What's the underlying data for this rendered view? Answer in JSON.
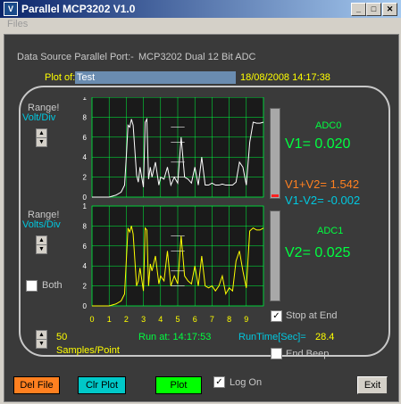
{
  "window": {
    "title": "Parallel MCP3202 V1.0",
    "icon": "app-icon"
  },
  "menu": {
    "files": "Files"
  },
  "header": {
    "source_label": "Data Source Parallel Port:-",
    "source_value": "MCP3202 Dual 12 Bit ADC",
    "plot_of_label": "Plot of:",
    "plot_of_value": "Test",
    "timestamp": "18/08/2008 14:17:38"
  },
  "left_controls": {
    "range1_label": "Range!",
    "range1_unit": "Volt/Div",
    "range2_label": "Range!",
    "range2_unit": "Volts/Div",
    "both_label": "Both",
    "samples_value": "50",
    "samples_label": "Samples/Point"
  },
  "right_panel": {
    "adc0_label": "ADC0",
    "v1": "V1= 0.020",
    "v1_plus_v2": "V1+V2= 1.542",
    "v1_minus_v2": "V1-V2=  -0.002",
    "adc1_label": "ADC1",
    "v2": "V2= 0.025",
    "stop_at_end_label": "Stop at End",
    "stop_at_end_checked": true,
    "runtime_label": "RunTime[Sec]=",
    "runtime_value": "28.4",
    "end_beep_label": "End Beep",
    "end_beep_checked": false
  },
  "run_at": "Run at: 14:17:53",
  "buttons": {
    "del_file": "Del File",
    "clr_plot": "Clr Plot",
    "plot": "Plot",
    "log_on": "Log On",
    "log_on_checked": true,
    "exit": "Exit"
  },
  "colors": {
    "panel_bg": "#3a3a3a",
    "grid": "#00ff40",
    "adc0_trace": "#ffffff",
    "adc1_trace": "#ffff00",
    "del_file": "#ff8020",
    "clr_plot": "#00c8c8",
    "plot": "#00ff00"
  },
  "chart_data": {
    "type": "line",
    "x_ticks": [
      "0",
      "1",
      "2",
      "3",
      "4",
      "5",
      "6",
      "7",
      "8",
      "9"
    ],
    "y_ticks": [
      "0",
      "0.2",
      "0.4",
      "0.6",
      "0.8",
      "1"
    ],
    "xlim": [
      0,
      10
    ],
    "ylim": [
      0,
      1
    ],
    "grid": true,
    "series": [
      {
        "channel": "ADC0",
        "x": [
          0,
          1,
          1.4,
          1.7,
          1.9,
          2.0,
          2.1,
          2.2,
          2.3,
          2.4,
          2.6,
          2.7,
          2.8,
          3.0,
          3.1,
          3.2,
          3.3,
          3.4,
          3.5,
          3.7,
          3.9,
          4.0,
          4.2,
          4.4,
          4.6,
          4.8,
          5.0,
          5.2,
          5.4,
          5.6,
          5.8,
          6.0,
          6.2,
          6.4,
          6.6,
          6.8,
          7.0,
          7.2,
          7.4,
          7.6,
          7.8,
          8.0,
          8.2,
          8.4,
          8.6,
          8.8,
          9.0,
          9.2,
          9.4,
          9.6,
          9.8,
          10
        ],
        "values": [
          0,
          0,
          0.02,
          0.05,
          0.12,
          0.4,
          0.72,
          0.7,
          0.78,
          0.72,
          0.22,
          0.15,
          0.3,
          0.1,
          0.75,
          0.78,
          0.18,
          0.3,
          0.2,
          0.35,
          0.12,
          0.2,
          0.18,
          0.3,
          0.12,
          0.2,
          0.14,
          0.6,
          0.2,
          0.18,
          0.14,
          0.3,
          0.12,
          0.4,
          0.12,
          0.12,
          0.14,
          0.12,
          0.12,
          0.13,
          0.12,
          0.12,
          0.12,
          0.15,
          0.35,
          0.3,
          0.12,
          0.55,
          0.75,
          0.74,
          0.74,
          0.75
        ]
      },
      {
        "channel": "ADC1",
        "x": [
          0,
          1,
          1.4,
          1.7,
          1.9,
          2.0,
          2.1,
          2.2,
          2.3,
          2.4,
          2.6,
          2.7,
          2.8,
          3.0,
          3.1,
          3.2,
          3.3,
          3.4,
          3.5,
          3.7,
          3.9,
          4.0,
          4.2,
          4.4,
          4.6,
          4.8,
          5.0,
          5.2,
          5.4,
          5.6,
          5.8,
          6.0,
          6.2,
          6.4,
          6.6,
          6.8,
          7.0,
          7.2,
          7.4,
          7.6,
          7.8,
          8.0,
          8.2,
          8.4,
          8.6,
          8.8,
          9.0,
          9.2,
          9.4,
          9.6,
          9.8,
          10
        ],
        "values": [
          0,
          0,
          0.02,
          0.05,
          0.12,
          0.45,
          0.78,
          0.74,
          0.8,
          0.72,
          0.2,
          0.25,
          0.38,
          0.15,
          0.78,
          0.76,
          0.2,
          0.42,
          0.35,
          0.5,
          0.22,
          0.3,
          0.25,
          0.55,
          0.2,
          0.3,
          0.22,
          0.7,
          0.3,
          0.25,
          0.22,
          0.4,
          0.2,
          0.5,
          0.2,
          0.18,
          0.2,
          0.15,
          0.2,
          0.3,
          0.12,
          0.18,
          0.15,
          0.45,
          0.55,
          0.35,
          0.18,
          0.75,
          0.78,
          0.76,
          0.76,
          0.78
        ]
      }
    ]
  }
}
